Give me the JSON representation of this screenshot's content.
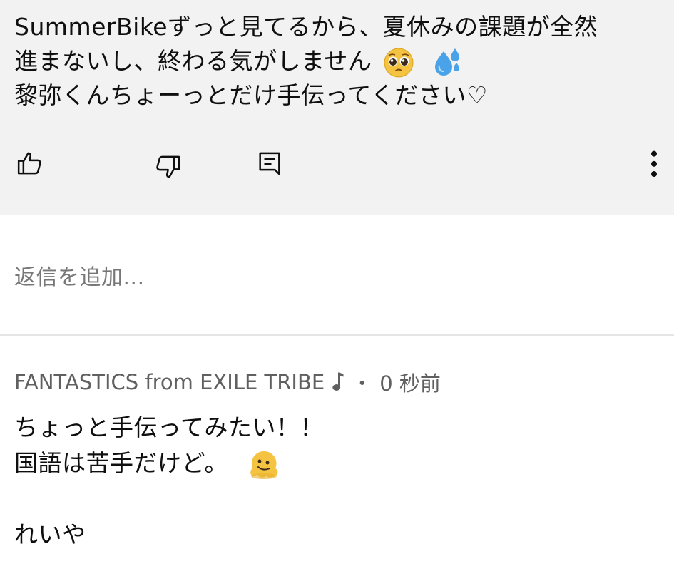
{
  "comment": {
    "lines": [
      "SummerBikeずっと見てるから、夏休みの課題が全然",
      "進まないし、終わる気がしません",
      "黎弥くんちょーっとだけ手伝ってください♡"
    ],
    "emojis": [
      "pleading-face",
      "sweat-droplets"
    ],
    "actions": [
      "like",
      "dislike",
      "reply",
      "more"
    ]
  },
  "reply_input": {
    "placeholder": "返信を追加..."
  },
  "reply": {
    "author": "FANTASTICS from EXILE TRIBE",
    "author_badge_icon": "music-note-icon",
    "separator": "・",
    "timestamp": "0 秒前",
    "lines": [
      "ちょっと手伝ってみたい！！",
      "国語は苦手だけど。",
      "",
      "れいや"
    ],
    "emoji": "melting-face"
  },
  "colors": {
    "card_background": "#f2f2f2",
    "text": "#0f0f0f",
    "muted_text": "#606060",
    "placeholder_text": "#777777",
    "divider": "#e5e5e5"
  }
}
